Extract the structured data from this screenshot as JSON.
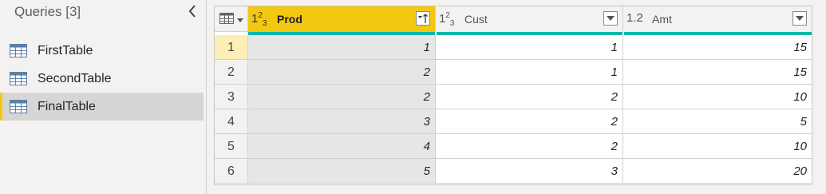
{
  "queries": {
    "title": "Queries [3]",
    "items": [
      {
        "label": "FirstTable",
        "selected": false
      },
      {
        "label": "SecondTable",
        "selected": false
      },
      {
        "label": "FinalTable",
        "selected": true
      }
    ]
  },
  "grid": {
    "columns": [
      {
        "type": "123",
        "name": "Prod",
        "selected": true,
        "sorted": "ascending"
      },
      {
        "type": "123",
        "name": "Cust",
        "selected": false
      },
      {
        "type": "1.2",
        "name": "Amt",
        "selected": false
      }
    ],
    "rows": [
      {
        "num": "1",
        "cells": [
          "1",
          "1",
          "15"
        ]
      },
      {
        "num": "2",
        "cells": [
          "2",
          "1",
          "15"
        ]
      },
      {
        "num": "3",
        "cells": [
          "2",
          "2",
          "10"
        ]
      },
      {
        "num": "4",
        "cells": [
          "3",
          "2",
          "5"
        ]
      },
      {
        "num": "5",
        "cells": [
          "4",
          "2",
          "10"
        ]
      },
      {
        "num": "6",
        "cells": [
          "5",
          "3",
          "20"
        ]
      }
    ]
  },
  "colors": {
    "accent": "#f2c811",
    "quality_bar": "#01b8aa",
    "selected_row": "#d8d6d4"
  }
}
